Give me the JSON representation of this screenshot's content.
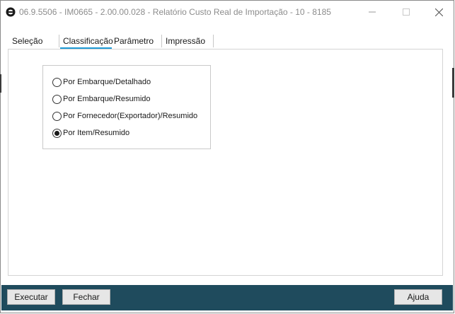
{
  "window": {
    "title": "06.9.5506 - IM0665 - 2.00.00.028 - Relatório Custo Real de Importação - 10 - 8185",
    "icons": {
      "app": "app-logo-icon",
      "minimize": "minimize-icon",
      "maximize": "maximize-icon",
      "close": "close-icon"
    }
  },
  "tabs": [
    {
      "label": "Seleção",
      "active": false
    },
    {
      "label": "Classificação",
      "active": true
    },
    {
      "label": "Parâmetro",
      "active": false
    },
    {
      "label": "Impressão",
      "active": false
    }
  ],
  "classification": {
    "options": [
      {
        "label": "Por Embarque/Detalhado",
        "selected": false
      },
      {
        "label": "Por Embarque/Resumido",
        "selected": false
      },
      {
        "label": "Por Fornecedor(Exportador)/Resumido",
        "selected": false
      },
      {
        "label": "Por Item/Resumido",
        "selected": true
      }
    ]
  },
  "footer": {
    "execute_label": "Executar",
    "close_label": "Fechar",
    "help_label": "Ajuda"
  },
  "colors": {
    "footer_bg": "#1f4b5d",
    "tab_active_underline": "#1e9ad6"
  }
}
